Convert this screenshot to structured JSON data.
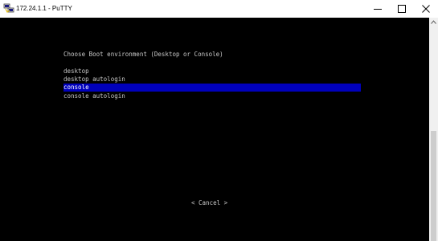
{
  "window": {
    "title": "172.24.1.1 - PuTTY",
    "icon": "putty-icon"
  },
  "controls": {
    "minimize_icon": "minimize-icon",
    "maximize_icon": "maximize-icon",
    "close_icon": "close-icon"
  },
  "terminal": {
    "background": "#000000",
    "text_color": "#c8c8c8",
    "highlight_color": "#0000bb",
    "menu_title": "Choose Boot environment (Desktop or Console)",
    "options": [
      {
        "label": "desktop",
        "selected": false
      },
      {
        "label": "desktop autologin",
        "selected": false
      },
      {
        "label": "console",
        "selected": true
      },
      {
        "label": "console autologin",
        "selected": false
      }
    ],
    "cancel_label": "< Cancel >"
  },
  "scrollbar": {
    "up_icon": "scroll-up-arrow-icon"
  }
}
